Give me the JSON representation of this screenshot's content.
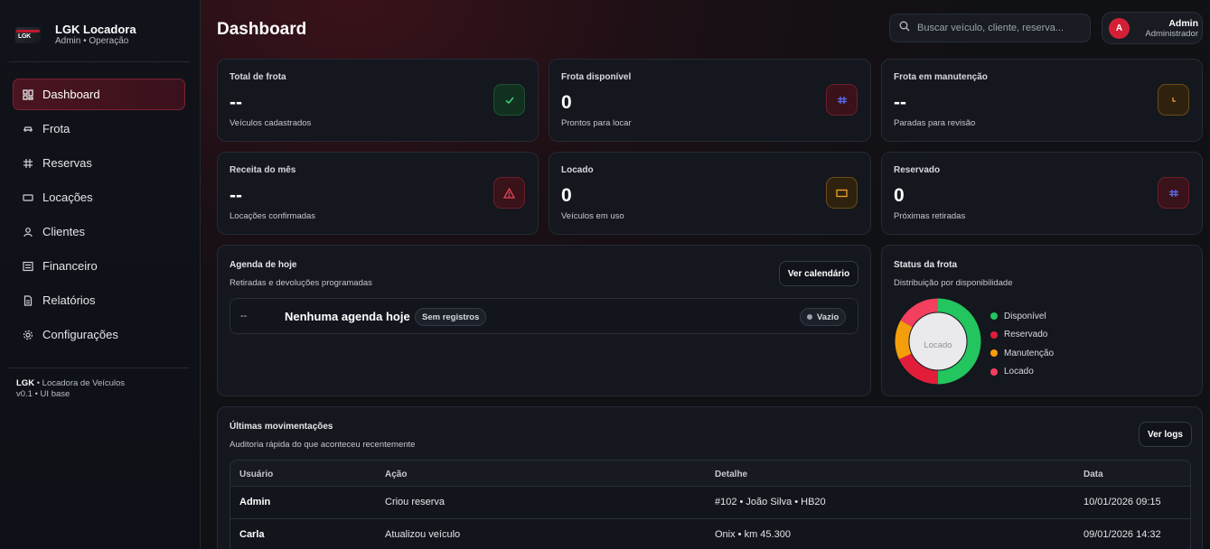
{
  "brand": {
    "logo_text": "LGK",
    "name": "LGK Locadora",
    "subtitle": "Admin • Operação"
  },
  "sidebar": {
    "items": [
      {
        "label": "Dashboard",
        "icon": "dashboard-icon",
        "active": true
      },
      {
        "label": "Frota",
        "icon": "car-icon"
      },
      {
        "label": "Reservas",
        "icon": "calendar-icon"
      },
      {
        "label": "Locações",
        "icon": "key-icon"
      },
      {
        "label": "Clientes",
        "icon": "user-icon"
      },
      {
        "label": "Financeiro",
        "icon": "wallet-icon"
      },
      {
        "label": "Relatórios",
        "icon": "report-icon"
      },
      {
        "label": "Configurações",
        "icon": "gear-icon"
      }
    ],
    "footer": {
      "brand": "LGK",
      "line1": "• Locadora de Veículos",
      "line2": "v0.1 • UI base"
    }
  },
  "header": {
    "title": "Dashboard",
    "search_placeholder": "Buscar veículo, cliente, reserva...",
    "user": {
      "initial": "A",
      "name": "Admin",
      "role": "Administrador"
    }
  },
  "kpis": [
    {
      "label": "Total de frota",
      "value": "--",
      "sub": "Veículos cadastrados",
      "icon": "check-icon",
      "tone": "green"
    },
    {
      "label": "Frota disponível",
      "value": "0",
      "sub": "Prontos para locar",
      "icon": "calendar-icon",
      "tone": "redblue"
    },
    {
      "label": "Frota em manutenção",
      "value": "--",
      "sub": "Paradas para revisão",
      "icon": "clock-icon",
      "tone": "amber"
    },
    {
      "label": "Receita do mês",
      "value": "--",
      "sub": "Locações confirmadas",
      "icon": "warning-icon",
      "tone": "red"
    },
    {
      "label": "Locado",
      "value": "0",
      "sub": "Veículos em uso",
      "icon": "card-icon",
      "tone": "amber"
    },
    {
      "label": "Reservado",
      "value": "0",
      "sub": "Próximas retiradas",
      "icon": "calendar-icon",
      "tone": "redblue"
    }
  ],
  "agenda": {
    "title": "Agenda de hoje",
    "subtitle": "Retiradas e devoluções programadas",
    "button": "Ver calendário",
    "row": {
      "time": "--",
      "message": "Nenhuma agenda hoje",
      "tag": "Sem registros",
      "status": "Vazio"
    }
  },
  "fleet_status": {
    "title": "Status da frota",
    "subtitle": "Distribuição por disponibilidade",
    "center_label": "Locado",
    "legend": [
      {
        "label": "Disponível",
        "color": "#22c55e"
      },
      {
        "label": "Reservado",
        "color": "#e11d3a"
      },
      {
        "label": "Manutenção",
        "color": "#f59e0b"
      },
      {
        "label": "Locado",
        "color": "#f43f5e"
      }
    ]
  },
  "chart_data": {
    "type": "pie",
    "title": "Status da frota",
    "categories": [
      "Disponível",
      "Reservado",
      "Manutenção",
      "Locado"
    ],
    "values": [
      50,
      18,
      15,
      17
    ]
  },
  "movements": {
    "title": "Últimas movimentações",
    "subtitle": "Auditoria rápida do que aconteceu recentemente",
    "button": "Ver logs",
    "columns": [
      "Usuário",
      "Ação",
      "Detalhe",
      "Data"
    ],
    "rows": [
      {
        "user": "Admin",
        "action": "Criou reserva",
        "detail": "#102 • João Silva • HB20",
        "date": "10/01/2026 09:15"
      },
      {
        "user": "Carla",
        "action": "Atualizou veículo",
        "detail": "Onix • km 45.300",
        "date": "09/01/2026 14:32"
      }
    ]
  }
}
